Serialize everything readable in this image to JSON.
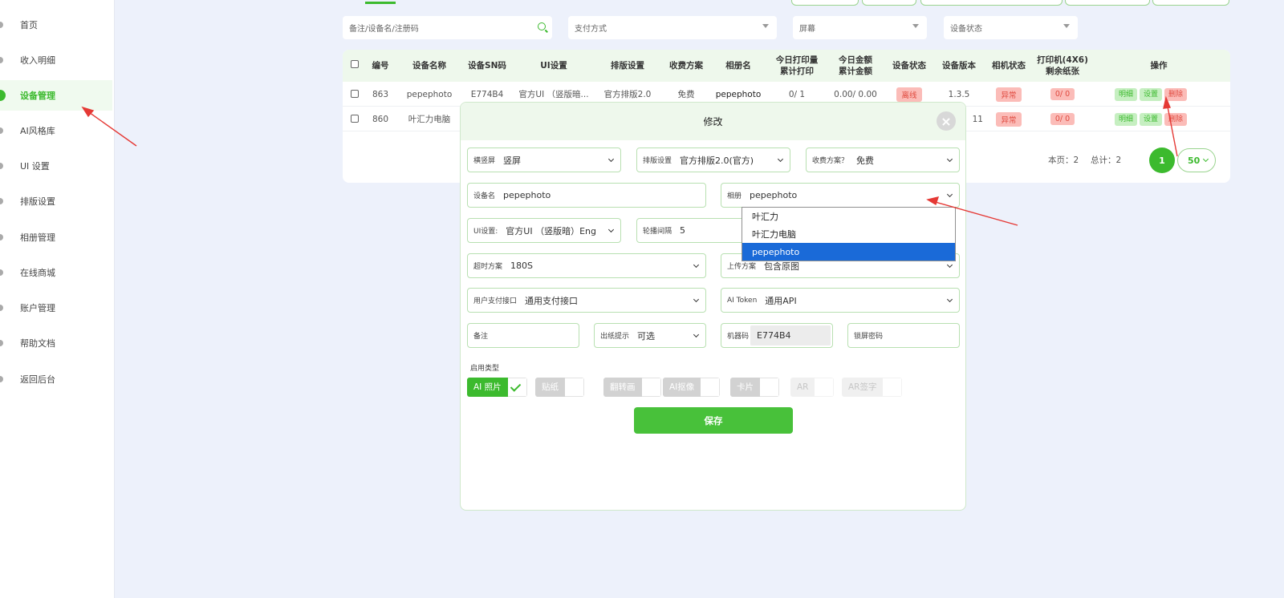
{
  "sidebar": {
    "items": [
      {
        "label": "首页",
        "active": false
      },
      {
        "label": "收入明细",
        "active": false
      },
      {
        "label": "设备管理",
        "active": true
      },
      {
        "label": "AI风格库",
        "active": false
      },
      {
        "label": "UI 设置",
        "active": false
      },
      {
        "label": "排版设置",
        "active": false
      },
      {
        "label": "相册管理",
        "active": false
      },
      {
        "label": "在线商城",
        "active": false
      },
      {
        "label": "账户管理",
        "active": false
      },
      {
        "label": "帮助文档",
        "active": false
      },
      {
        "label": "返回后台",
        "active": false
      }
    ]
  },
  "filters": {
    "search_placeholder": "备注/设备名/注册码",
    "payment_placeholder": "支付方式",
    "screen_placeholder": "屏幕",
    "status_placeholder": "设备状态"
  },
  "table": {
    "headers": [
      {
        "l1": "编号",
        "l2": ""
      },
      {
        "l1": "设备名称",
        "l2": ""
      },
      {
        "l1": "设备SN码",
        "l2": ""
      },
      {
        "l1": "UI设置",
        "l2": ""
      },
      {
        "l1": "排版设置",
        "l2": ""
      },
      {
        "l1": "收费方案",
        "l2": ""
      },
      {
        "l1": "相册名",
        "l2": ""
      },
      {
        "l1": "今日打印量",
        "l2": "累计打印"
      },
      {
        "l1": "今日金额",
        "l2": "累计金额"
      },
      {
        "l1": "设备状态",
        "l2": ""
      },
      {
        "l1": "设备版本",
        "l2": ""
      },
      {
        "l1": "相机状态",
        "l2": ""
      },
      {
        "l1": "打印机(4X6)",
        "l2": "剩余纸张"
      },
      {
        "l1": "操作",
        "l2": ""
      }
    ],
    "rows": [
      {
        "id": "863",
        "name": "pepephoto",
        "sn": "E774B4",
        "ui": "官方UI （竖版暗...",
        "layout": "官方排版2.0",
        "fee": "免费",
        "album": "pepephoto",
        "prints": "0/ 1",
        "amount": "0.00/ 0.00",
        "status": "离线",
        "version": "1.3.5",
        "camera": "异常",
        "paper": "0/ 0",
        "ops": [
          "明细",
          "设置",
          "删除"
        ]
      },
      {
        "id": "860",
        "name": "叶汇力电脑",
        "version": "11",
        "camera": "异常",
        "paper": "0/ 0",
        "ops": [
          "明细",
          "设置",
          "删除"
        ]
      }
    ],
    "pager_page": "本页：2",
    "pager_total": "总计：2",
    "pager_current": "1",
    "pager_size": "50"
  },
  "modal": {
    "title": "修改",
    "close": "×",
    "orientation": {
      "label": "横竖屏",
      "value": "竖屏"
    },
    "layout": {
      "label": "排版设置",
      "value": "官方排版2.0(官方)"
    },
    "fee": {
      "label": "收费方案？",
      "value": "免费"
    },
    "device_name": {
      "label": "设备名",
      "value": "pepephoto"
    },
    "album": {
      "label": "相册",
      "value": "pepephoto"
    },
    "ui": {
      "label": "UI设置:",
      "value": "官方UI （竖版暗）Eng"
    },
    "interval": {
      "label": "轮播间隔",
      "value": "5"
    },
    "timeout": {
      "label": "超时方案",
      "value": "180S"
    },
    "upload": {
      "label": "上传方案",
      "value": "包含原图"
    },
    "pay_api": {
      "label": "用户支付接口",
      "value": "通用支付接口"
    },
    "ai_token": {
      "label": "AI Token",
      "value": "通用API"
    },
    "remark": {
      "label": "备注",
      "value": ""
    },
    "print_tip": {
      "label": "出纸提示",
      "value": "可选"
    },
    "machine_code": {
      "label": "机器码",
      "value": "E774B4"
    },
    "lock_pwd": {
      "label": "锁屏密码",
      "value": ""
    },
    "enable_label": "启用类型",
    "types": [
      {
        "label": "AI 照片",
        "state": "on"
      },
      {
        "label": "贴纸",
        "state": "off"
      },
      {
        "label": "翻转画",
        "state": "off"
      },
      {
        "label": "AI抠像",
        "state": "off"
      },
      {
        "label": "卡片",
        "state": "off"
      },
      {
        "label": "AR",
        "state": "disabled"
      },
      {
        "label": "AR签字",
        "state": "disabled"
      }
    ],
    "save": "保存"
  },
  "album_dropdown": {
    "options": [
      "叶汇力",
      "叶汇力电脑",
      "pepephoto"
    ],
    "selected": "pepephoto"
  },
  "colors": {
    "accent": "#3cba2e",
    "danger": "#e04a3f",
    "select_blue": "#1a6ad8",
    "annotation": "#e53935"
  }
}
